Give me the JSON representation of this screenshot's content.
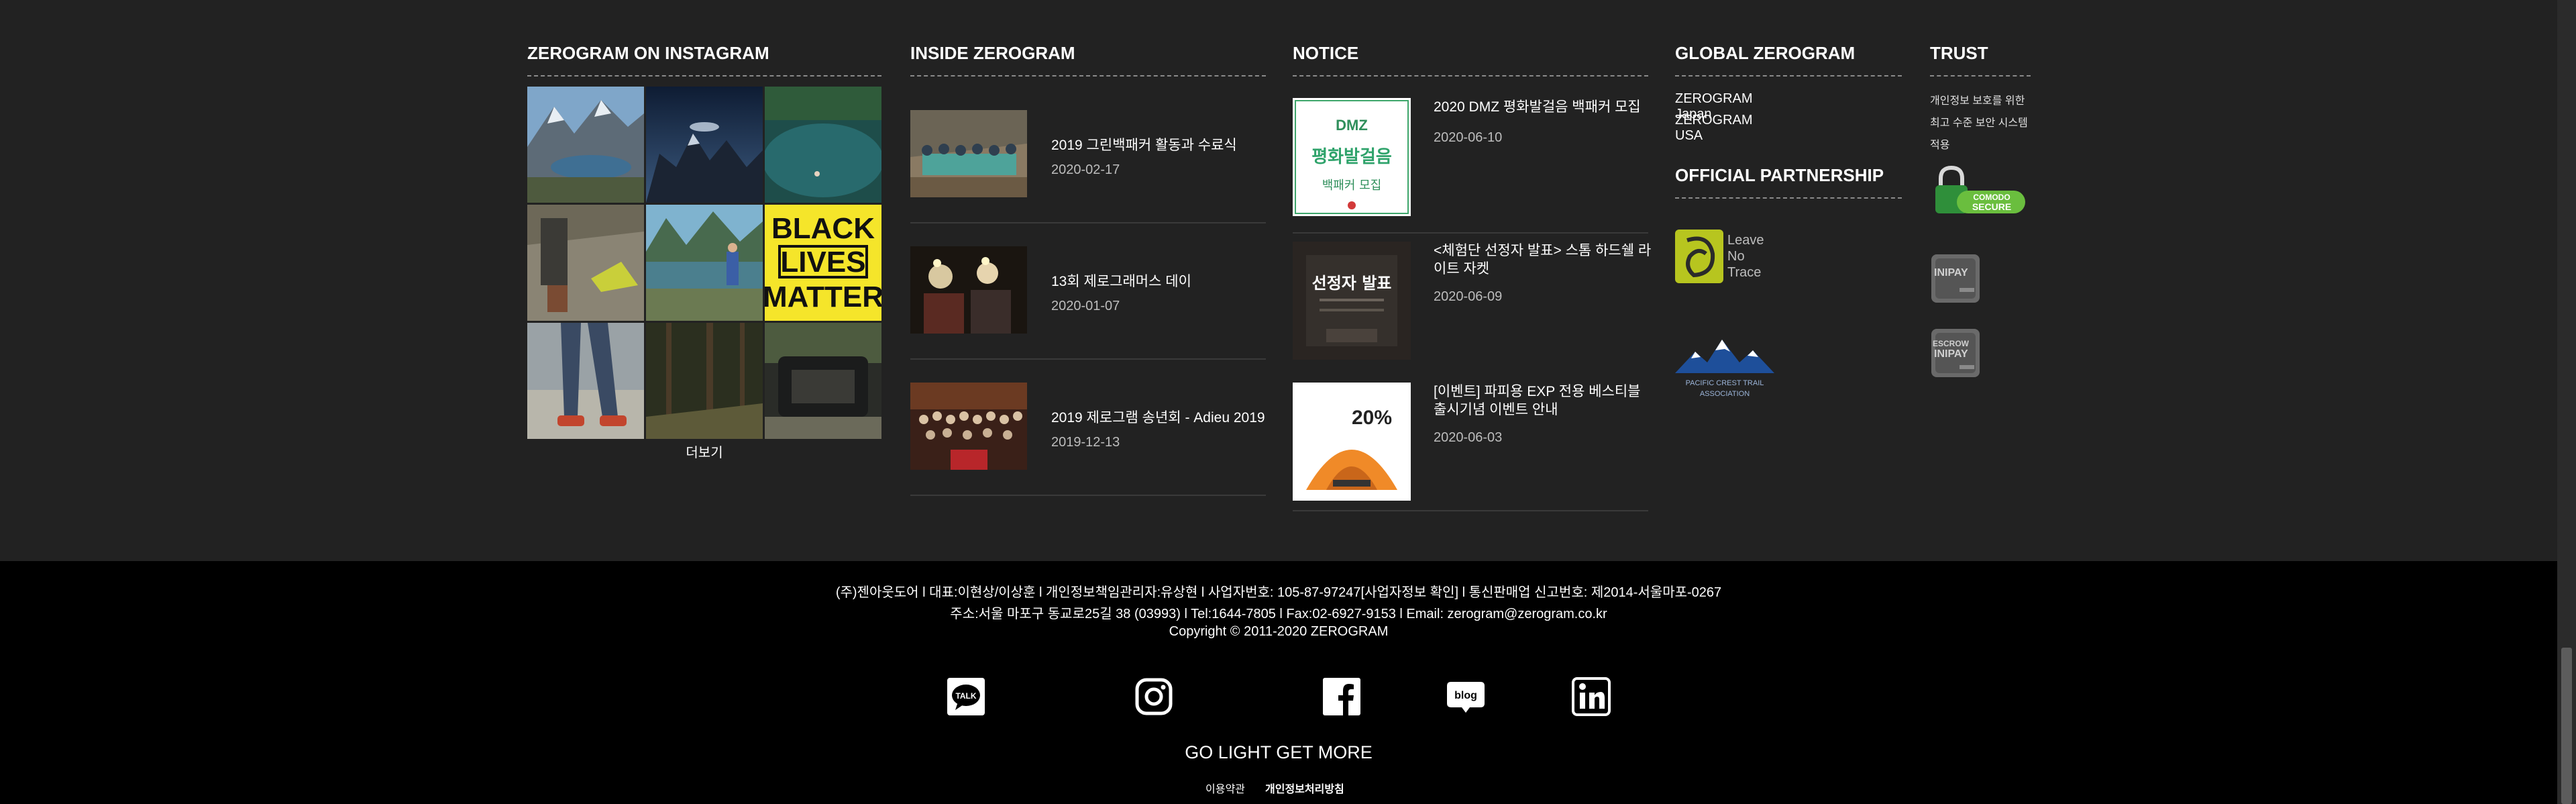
{
  "instagram": {
    "title": "ZEROGRAM ON INSTAGRAM",
    "more_label": "더보기",
    "tiles": [
      "mountain-lake",
      "night-sky-mountains",
      "alpine-lake-swimmer",
      "tent-on-rocks",
      "hiker-by-lake",
      "black-lives-matter",
      "hiking-legs",
      "forest-trail",
      "car-camping"
    ],
    "blm_lines": [
      "BLACK",
      "LIVES",
      "MATTER"
    ]
  },
  "inside": {
    "title": "INSIDE ZEROGRAM",
    "items": [
      {
        "title": "2019 그린백패커 활동과 수료식",
        "date": "2020-02-17"
      },
      {
        "title": "13회 제로그래머스 데이",
        "date": "2020-01-07"
      },
      {
        "title": "2019 제로그램 송년회 - Adieu 2019",
        "date": "2019-12-13"
      }
    ]
  },
  "notice": {
    "title": "NOTICE",
    "items": [
      {
        "title": "2020 DMZ 평화발걸음 백패커 모집",
        "date": "2020-06-10",
        "thumb_text": "2020 DMZ 평화발걸음 백패커 모집"
      },
      {
        "title": "<체험단 선정자 발표> 스톰 하드쉘 라이트 자켓",
        "date": "2020-06-09",
        "thumb_text": "선정자 발표"
      },
      {
        "title": "[이벤트] 파피용 EXP 전용 베스티블 출시기념 이벤트 안내",
        "date": "2020-06-03",
        "thumb_text": "20%"
      }
    ]
  },
  "global": {
    "title": "GLOBAL ZEROGRAM",
    "links": [
      "ZEROGRAM Japan",
      "ZEROGRAM USA"
    ],
    "partnership_title": "OFFICIAL PARTNERSHIP",
    "partners": [
      {
        "name": "Leave No Trace",
        "lines": [
          "Leave",
          "No",
          "Trace"
        ]
      },
      {
        "name": "Pacific Crest Trail Association",
        "lines": [
          "PACIFIC CREST TRAIL",
          "ASSOCIATION"
        ]
      }
    ]
  },
  "trust": {
    "title": "TRUST",
    "text": "개인정보 보호를 위한 최고 수준 보안 시스템 적용",
    "badges": [
      "COMODO SECURE",
      "INIPAY",
      "ESCROW INIPAY"
    ]
  },
  "footer": {
    "line1": "(주)젠아웃도어 l 대표:이현상/이상훈 l 개인정보책임관리자:유상현 l 사업자번호: 105-87-97247[사업자정보 확인] l 통신판매업 신고번호: 제2014-서울마포-0267",
    "line2": "주소:서울 마포구 동교로25길 38 (03993) l Tel:1644-7805 l Fax:02-6927-9153 l Email: zerogram@zerogram.co.kr",
    "copyright": "Copyright © 2011-2020 ZEROGRAM",
    "slogan": "GO LIGHT GET MORE",
    "terms": "이용약관",
    "privacy": "개인정보처리방침",
    "social": [
      "kakaotalk-icon",
      "instagram-icon",
      "facebook-icon",
      "blog-icon",
      "linkedin-icon"
    ],
    "kakao_label": "TALK",
    "blog_label": "blog"
  }
}
